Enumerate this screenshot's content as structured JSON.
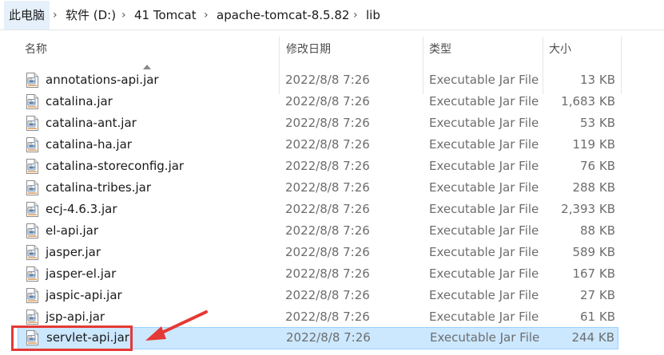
{
  "breadcrumb": [
    "此电脑",
    "软件 (D:)",
    "41 Tomcat",
    "apache-tomcat-8.5.82",
    "lib"
  ],
  "columns": {
    "name": "名称",
    "date": "修改日期",
    "type": "类型",
    "size": "大小"
  },
  "files": [
    {
      "name": "annotations-api.jar",
      "date": "2022/8/8 7:26",
      "type": "Executable Jar File",
      "size": "13 KB"
    },
    {
      "name": "catalina.jar",
      "date": "2022/8/8 7:26",
      "type": "Executable Jar File",
      "size": "1,683 KB"
    },
    {
      "name": "catalina-ant.jar",
      "date": "2022/8/8 7:26",
      "type": "Executable Jar File",
      "size": "53 KB"
    },
    {
      "name": "catalina-ha.jar",
      "date": "2022/8/8 7:26",
      "type": "Executable Jar File",
      "size": "119 KB"
    },
    {
      "name": "catalina-storeconfig.jar",
      "date": "2022/8/8 7:26",
      "type": "Executable Jar File",
      "size": "76 KB"
    },
    {
      "name": "catalina-tribes.jar",
      "date": "2022/8/8 7:26",
      "type": "Executable Jar File",
      "size": "288 KB"
    },
    {
      "name": "ecj-4.6.3.jar",
      "date": "2022/8/8 7:26",
      "type": "Executable Jar File",
      "size": "2,393 KB"
    },
    {
      "name": "el-api.jar",
      "date": "2022/8/8 7:26",
      "type": "Executable Jar File",
      "size": "88 KB"
    },
    {
      "name": "jasper.jar",
      "date": "2022/8/8 7:26",
      "type": "Executable Jar File",
      "size": "589 KB"
    },
    {
      "name": "jasper-el.jar",
      "date": "2022/8/8 7:26",
      "type": "Executable Jar File",
      "size": "167 KB"
    },
    {
      "name": "jaspic-api.jar",
      "date": "2022/8/8 7:26",
      "type": "Executable Jar File",
      "size": "27 KB"
    },
    {
      "name": "jsp-api.jar",
      "date": "2022/8/8 7:26",
      "type": "Executable Jar File",
      "size": "61 KB"
    },
    {
      "name": "servlet-api.jar",
      "date": "2022/8/8 7:26",
      "type": "Executable Jar File",
      "size": "244 KB",
      "selected": true
    }
  ],
  "colors": {
    "selection_bg": "#cce8ff",
    "selection_border": "#99d1ff",
    "annotation": "#e53935"
  },
  "icons": {
    "file": "java-jar-icon",
    "separator": "chevron-right-icon",
    "sort": "sort-ascending-icon"
  }
}
